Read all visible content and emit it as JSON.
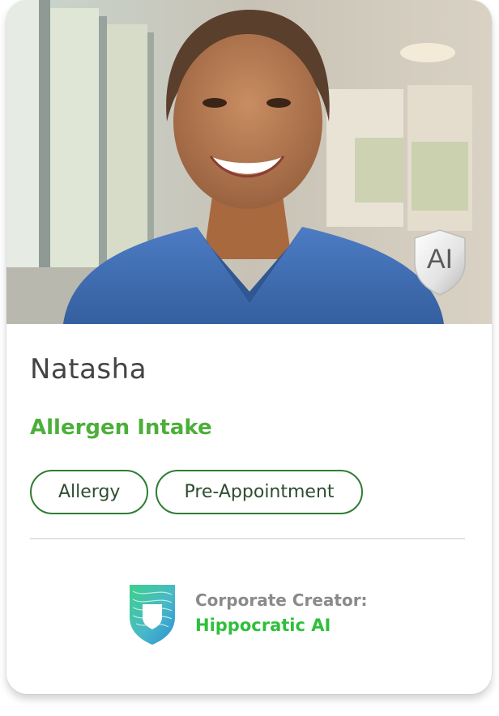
{
  "profile": {
    "name": "Natasha",
    "role": "Allergen Intake",
    "badge_label": "AI",
    "photo_subject": "smiling nurse in blue scrubs in a hospital hallway"
  },
  "tags": [
    {
      "label": "Allergy"
    },
    {
      "label": "Pre-Appointment"
    }
  ],
  "creator": {
    "label": "Corporate Creator:",
    "name": "Hippocratic AI"
  },
  "colors": {
    "role_green": "#4caf3a",
    "tag_border": "#2e7d32",
    "creator_name_green": "#2fbf3a",
    "scrubs_blue": "#3f6fb8"
  }
}
